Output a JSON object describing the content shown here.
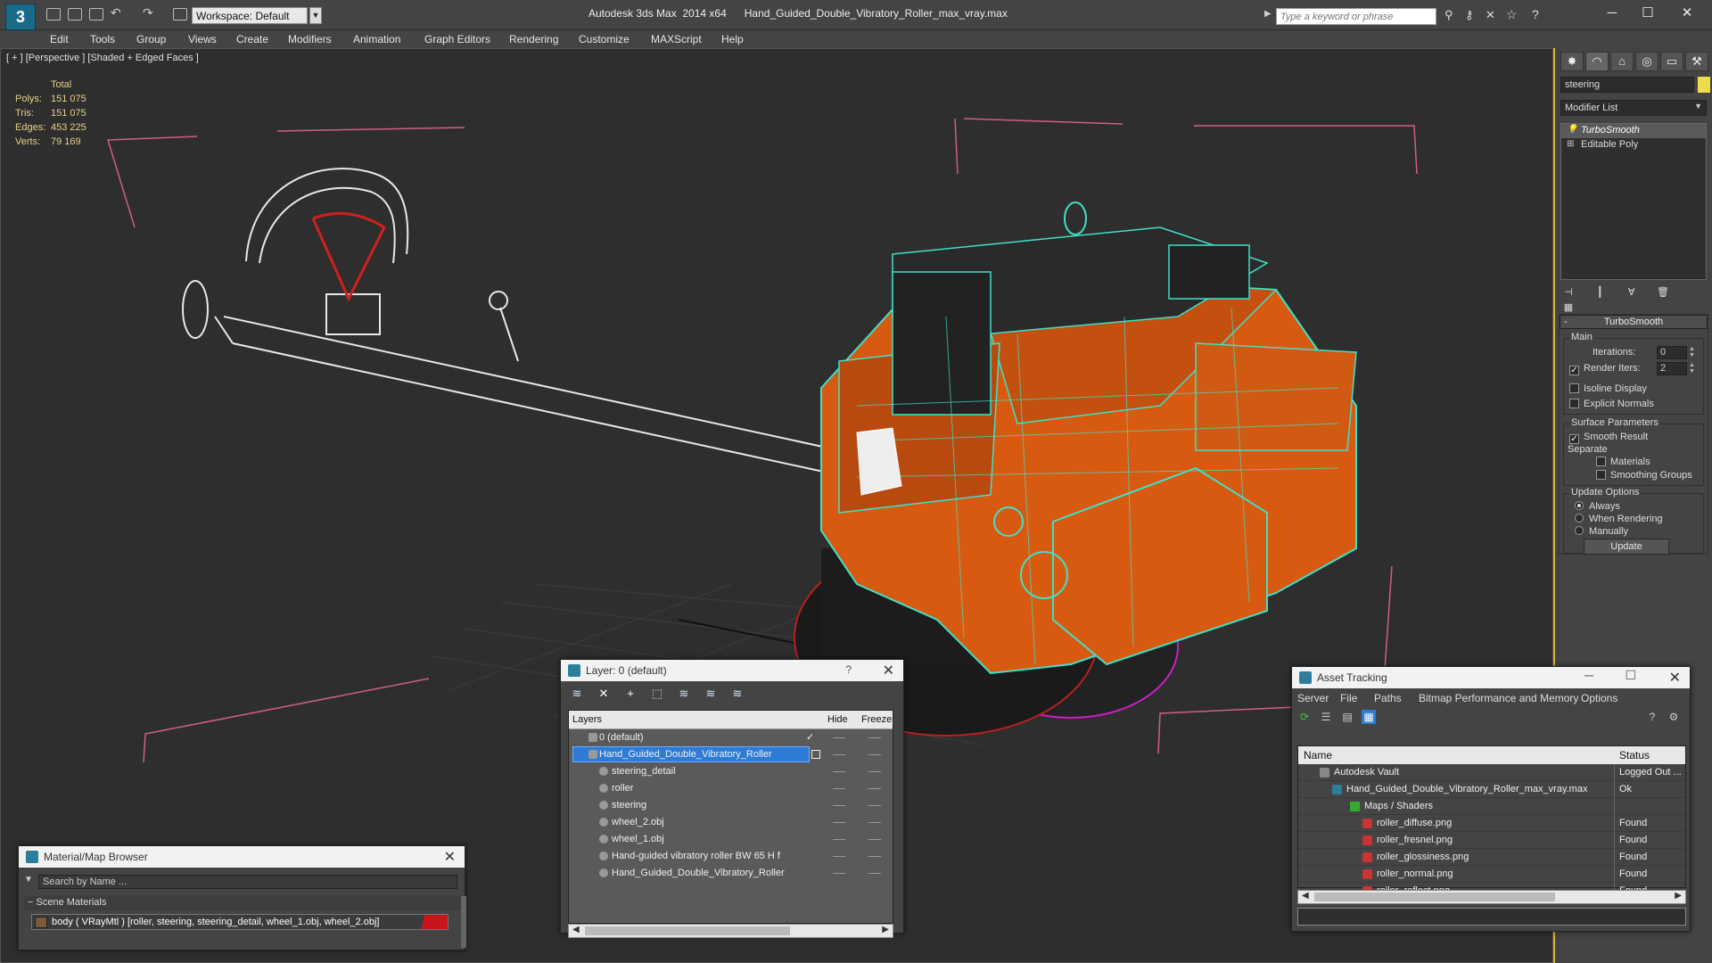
{
  "app": {
    "title": "Autodesk 3ds Max  2014 x64      Hand_Guided_Double_Vibratory_Roller_max_vray.max",
    "workspace": "Workspace: Default",
    "search_placeholder": "Type a keyword or phrase"
  },
  "menu": [
    "Edit",
    "Tools",
    "Group",
    "Views",
    "Create",
    "Modifiers",
    "Animation",
    "Graph Editors",
    "Rendering",
    "Customize",
    "MAXScript",
    "Help"
  ],
  "viewport": {
    "label": "[ + ] [Perspective ] [Shaded + Edged Faces ]",
    "stats": {
      "header": "Total",
      "polys_label": "Polys:",
      "polys": "151 075",
      "tris_label": "Tris:",
      "tris": "151 075",
      "edges_label": "Edges:",
      "edges": "453 225",
      "verts_label": "Verts:",
      "verts": "79 169"
    }
  },
  "command_panel": {
    "object_name": "steering",
    "object_color": "#f0dc4a",
    "modifier_list": "Modifier List",
    "stack": [
      "TurboSmooth",
      "Editable Poly"
    ],
    "turbosmooth": {
      "title": "TurboSmooth",
      "main_label": "Main",
      "iterations_label": "Iterations:",
      "iterations": "0",
      "render_iters_label": "Render Iters:",
      "render_iters": "2",
      "isoline": "Isoline Display",
      "explicit_normals": "Explicit Normals",
      "surface_params": "Surface Parameters",
      "smooth_result": "Smooth Result",
      "separate": "Separate",
      "materials": "Materials",
      "smoothing_groups": "Smoothing Groups",
      "update_options": "Update Options",
      "always": "Always",
      "when_rendering": "When Rendering",
      "manually": "Manually",
      "update_button": "Update"
    }
  },
  "layer_window": {
    "title": "Layer: 0 (default)",
    "help": "?",
    "col_layers": "Layers",
    "col_hide": "Hide",
    "col_freeze": "Freeze",
    "rows": [
      "0 (default)",
      "Hand_Guided_Double_Vibratory_Roller",
      "steering_detail",
      "roller",
      "steering",
      "wheel_2.obj",
      "wheel_1.obj",
      "Hand-guided vibratory roller BW 65 H f",
      "Hand_Guided_Double_Vibratory_Roller"
    ]
  },
  "material_browser": {
    "title": "Material/Map Browser",
    "search_placeholder": "Search by Name ...",
    "section": "Scene Materials",
    "item": "body  ( VRayMtl )  [roller, steering, steering_detail, wheel_1.obj, wheel_2.obj]"
  },
  "asset_tracking": {
    "title": "Asset Tracking",
    "menu": [
      "Server",
      "File",
      "Paths",
      "Bitmap Performance and Memory",
      "Options"
    ],
    "col_name": "Name",
    "col_status": "Status",
    "rows": [
      {
        "name": "Autodesk Vault",
        "status": "Logged Out ..."
      },
      {
        "name": "Hand_Guided_Double_Vibratory_Roller_max_vray.max",
        "status": "Ok"
      },
      {
        "name": "Maps / Shaders",
        "status": ""
      },
      {
        "name": "roller_diffuse.png",
        "status": "Found"
      },
      {
        "name": "roller_fresnel.png",
        "status": "Found"
      },
      {
        "name": "roller_glossiness.png",
        "status": "Found"
      },
      {
        "name": "roller_normal.png",
        "status": "Found"
      },
      {
        "name": "roller_reflect.png",
        "status": "Found"
      }
    ]
  },
  "colors": {
    "accent": "#e0b030",
    "selection": "#2d7bd4",
    "wire": "#40e0c8",
    "body": "#d85a10"
  }
}
